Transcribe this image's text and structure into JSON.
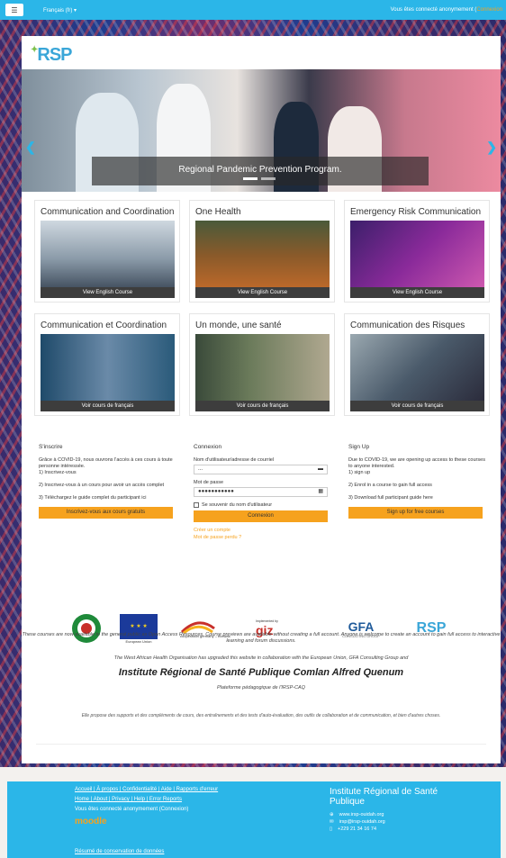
{
  "topbar": {
    "menu_icon": "hamburger-icon",
    "language": "Français (fr) ▾",
    "login_status_prefix": "Vous êtes connecté anonymement (",
    "login_link": "Connexion"
  },
  "logo_text": "RSP",
  "hero": {
    "caption": "Regional Pandemic Prevention Program.",
    "slides_count": 2,
    "active_slide": 1
  },
  "courses": [
    {
      "title": "Communication and Coordination",
      "button": "View English Course"
    },
    {
      "title": "One Health",
      "button": "View English Course"
    },
    {
      "title": "Emergency Risk Communication",
      "button": "View English Course"
    },
    {
      "title": "Communication et Coordination",
      "button": "Voir cours de français"
    },
    {
      "title": "Un monde, une santé",
      "button": "Voir cours de français"
    },
    {
      "title": "Communication des Risques",
      "button": "Voir cours de français"
    }
  ],
  "signup_fr": {
    "heading": "S'inscrire",
    "p1": "Grâce à COVID-19, nous ouvrons l'accès à ces cours à toute personne intéressée.",
    "step1": "1) Inscrivez-vous",
    "step2": "2) Inscrivez-vous à un cours pour avoir un accès complet",
    "step3": "3) Téléchargez le guide complet du participant ici",
    "button": "Inscrivez-vous aux cours gratuits"
  },
  "login": {
    "heading": "Connexion",
    "username_label": "Nom d'utilisateur/adresse de courriel",
    "username_value": "...",
    "password_label": "Mot de passe",
    "password_value": "●●●●●●●●●●●",
    "remember": "Se souvenir du nom d'utilisateur",
    "button": "Connexion",
    "create_account": "Créer un compte",
    "forgot_password": "Mot de passe perdu ?"
  },
  "signup_en": {
    "heading": "Sign Up",
    "p1": "Due to COVID-19, we are opening up access to these courses to anyone interested.",
    "step1": "1) sign up",
    "step2": "2) Enrol in a course to gain full access",
    "step3": "3) Download full participant guide here",
    "button": "Sign up for free courses"
  },
  "partners": {
    "eu_label": "European Union",
    "coop_label": "cooperation germany – ecowas",
    "giz_pre": "Implemented by",
    "giz_label": "giz",
    "gfa_label": "GFA",
    "gfa_sub": "CONSULTING GROUP",
    "irsp_label": "RSP"
  },
  "info": {
    "line1": "These courses are now available to the general public as Open Access Resources. Course previews are available without creating a full account. Anyone is  welcome to  create an account to gain full access to interactive learning and forum discussions.",
    "line2": "The West African Health Organisation has upgraded this website in collaboration with  the European Union, GFA Consulting Group and",
    "institute": "Institute Régional de Santé Publique Comlan Alfred Quenum",
    "platform": "Plateforme pédagogique de l'IRSP-CAQ",
    "description": "Elle propose des supports et des compléments de cours, des entraînements et des tests d'auto-évaluation, des outils de collaboration et de communication, et bien d'autres choses."
  },
  "footer": {
    "links1": "Accueil | À propos | Confidentialité | Aide | Rapports d'erreur",
    "links2": "Home | About | Privacy | Help | Error Reports",
    "status": "Vous êtes connecté anonymement (Connexion)",
    "moodle": "moodle",
    "data_summary": "Résumé de conservation de données",
    "inst_title": "Institute Régional de Santé Publique",
    "website": "www.irsp-ouidah.org",
    "email": "irsp@irsp-ouidah.org",
    "phone": "+229 21 34 16 74"
  }
}
